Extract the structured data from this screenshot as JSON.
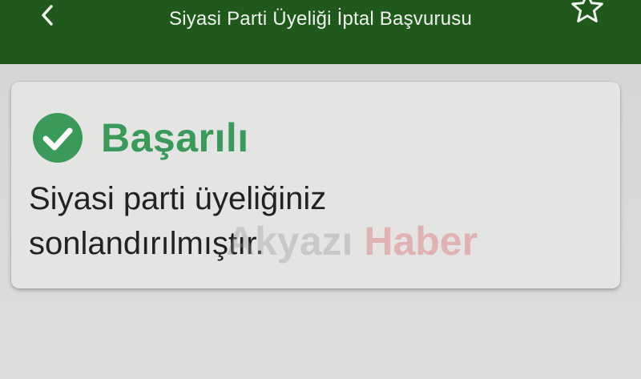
{
  "header": {
    "title": "Siyasi Parti Üyeliği İptal Başvurusu",
    "back_icon": "chevron-left-icon",
    "favorite_icon": "star-outline-icon"
  },
  "result_card": {
    "status_icon": "check-circle-icon",
    "status_title": "Başarılı",
    "message": "Siyasi parti üyeliğiniz sonlandırılmıştır."
  },
  "watermark": {
    "part1": "Akyazı",
    "part2": "Haber"
  },
  "colors": {
    "header_bg": "#1f5a1c",
    "success_green": "#3a9a5a",
    "text_dark": "#222222"
  }
}
